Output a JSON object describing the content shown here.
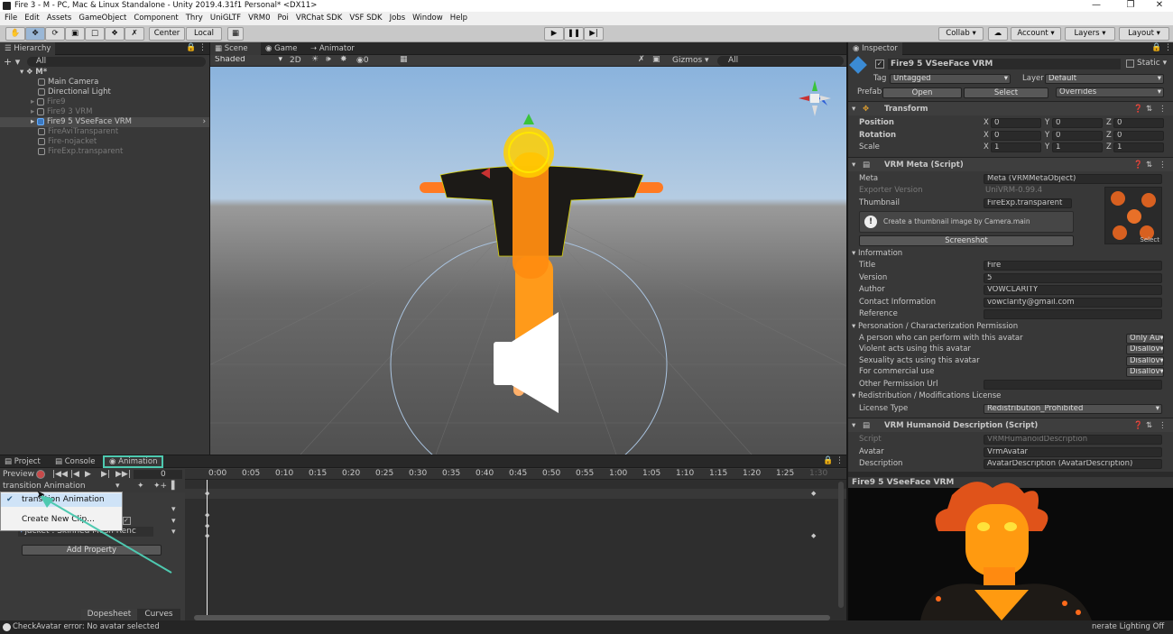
{
  "window": {
    "title": "Fire 3 - M - PC, Mac & Linux Standalone - Unity 2019.4.31f1 Personal* <DX11>"
  },
  "menu": [
    "File",
    "Edit",
    "Assets",
    "GameObject",
    "Component",
    "Thry",
    "UniGLTF",
    "VRM0",
    "Poi",
    "VRChat SDK",
    "VSF SDK",
    "Jobs",
    "Window",
    "Help"
  ],
  "toolbar": {
    "center": "Center",
    "local": "Local",
    "collab": "Collab",
    "account": "Account",
    "layers": "Layers",
    "layout": "Layout"
  },
  "hierarchy": {
    "tab": "Hierarchy",
    "search": "All",
    "scene": "M*",
    "items": [
      "Main Camera",
      "Directional Light",
      "Fire9",
      "Fire9 3 VRM",
      "Fire9 5 VSeeFace VRM",
      "FireAviTransparent",
      "Fire-nojacket",
      "FireExp.transparent"
    ]
  },
  "scene_tabs": [
    "Scene",
    "Game",
    "Animator"
  ],
  "scene_toolbar": {
    "shading": "Shaded",
    "mode": "2D",
    "fx_count": "0",
    "gizmos": "Gizmos",
    "search": "All"
  },
  "inspector": {
    "tab": "Inspector",
    "object_name": "Fire9 5 VSeeFace VRM",
    "static": "Static",
    "tag_label": "Tag",
    "tag": "Untagged",
    "layer_label": "Layer",
    "layer": "Default",
    "prefab_label": "Prefab",
    "open": "Open",
    "select": "Select",
    "overrides": "Overrides",
    "transform": {
      "title": "Transform",
      "position_label": "Position",
      "rotation_label": "Rotation",
      "scale_label": "Scale",
      "position": [
        "0",
        "0",
        "0"
      ],
      "rotation": [
        "0",
        "0",
        "0"
      ],
      "scale": [
        "1",
        "1",
        "1"
      ],
      "axes": [
        "X",
        "Y",
        "Z"
      ]
    },
    "vrm_meta": {
      "title": "VRM Meta (Script)",
      "meta_label": "Meta",
      "meta": "Meta (VRMMetaObject)",
      "exporter_label": "Exporter Version",
      "exporter": "UniVRM-0.99.4",
      "thumb_label": "Thumbnail",
      "thumb": "FireExp.transparent",
      "hint": "Create a thumbnail image by Camera.main",
      "screenshot": "Screenshot",
      "select": "Select",
      "information": "Information",
      "title_label": "Title",
      "title_val": "Fire",
      "version_label": "Version",
      "version_val": "5",
      "author_label": "Author",
      "author_val": "VOWCLARITY",
      "contact_label": "Contact Information",
      "contact_val": "vowclarity@gmail.com",
      "reference_label": "Reference",
      "permission_header": "Personation / Characterization Permission",
      "perform_label": "A person who can perform with this avatar",
      "perform_val": "Only Au",
      "violent_label": "Violent acts using this avatar",
      "violent_val": "Disallov",
      "sexual_label": "Sexuality acts using this avatar",
      "sexual_val": "Disallov",
      "commercial_label": "For commercial use",
      "commercial_val": "Disallov",
      "other_url_label": "Other Permission Url",
      "redistribution_header": "Redistribution / Modifications License",
      "license_label": "License Type",
      "license_val": "Redistribution_Prohibited"
    },
    "humanoid": {
      "title": "VRM Humanoid Description (Script)",
      "script_label": "Script",
      "script_val": "VRMHumanoidDescription",
      "avatar_label": "Avatar",
      "avatar_val": "VrmAvatar",
      "desc_label": "Description",
      "desc_val": "AvatarDescription (AvatarDescription)"
    },
    "footer_name": "Fire9 5 VSeeFace VRM"
  },
  "animation": {
    "tabs": [
      "Project",
      "Console",
      "Animation"
    ],
    "preview": "Preview",
    "frame": "0",
    "clip": "transition Animation",
    "dropdown_items": [
      "transition Animation",
      "Create New Clip..."
    ],
    "property": "jacket : Skinned Mesh Renc",
    "add_property": "Add Property",
    "dopesheet": "Dopesheet",
    "curves": "Curves",
    "times": [
      "0:00",
      "0:05",
      "0:10",
      "0:15",
      "0:20",
      "0:25",
      "0:30",
      "0:35",
      "0:40",
      "0:45",
      "0:50",
      "0:55",
      "1:00",
      "1:05",
      "1:10",
      "1:15",
      "1:20",
      "1:25",
      "1:30"
    ]
  },
  "status": {
    "error": "CheckAvatar error: No avatar selected",
    "lighting": "nerate Lighting Off"
  },
  "colors": {
    "accent": "#4ec9b0",
    "selected_blue": "#2c5d87",
    "fire_orange": "#ff9a1a",
    "jacket": "#1a1a1a"
  }
}
